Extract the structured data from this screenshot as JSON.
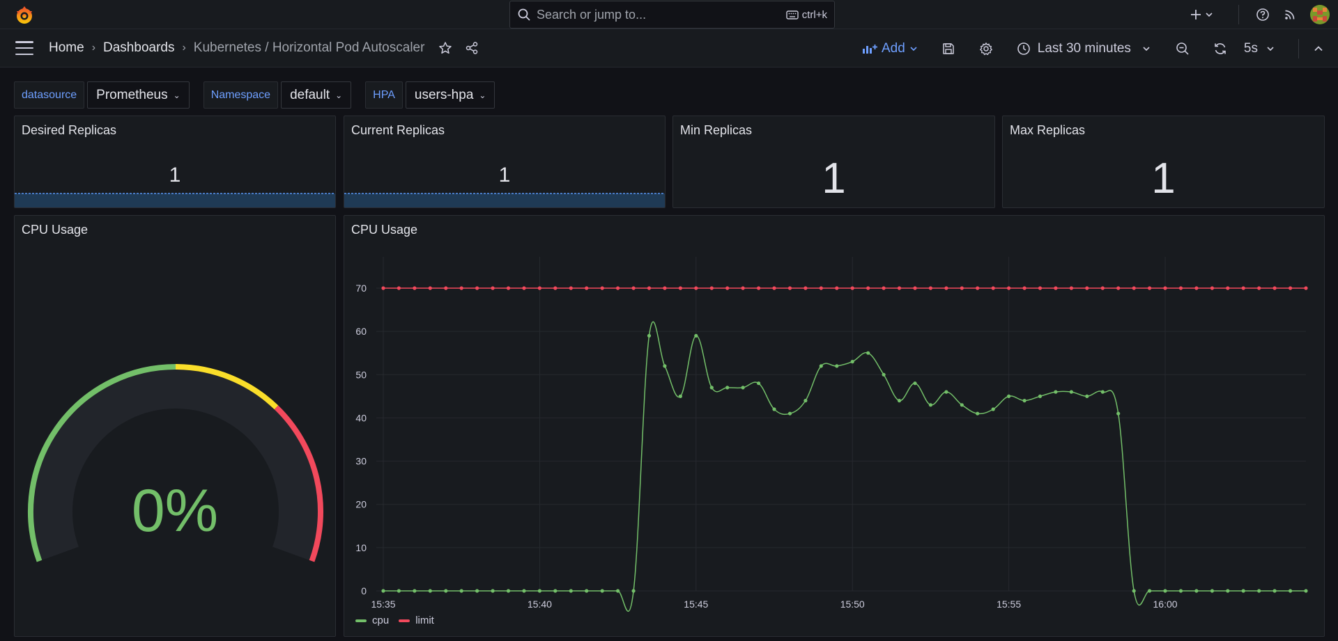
{
  "topbar": {
    "search_placeholder": "Search or jump to...",
    "search_shortcut": "ctrl+k",
    "icons": [
      "grafana-logo-icon",
      "search-icon",
      "keyboard-icon",
      "plus-icon",
      "help-icon",
      "news-rss-icon",
      "user-avatar"
    ]
  },
  "breadcrumb": {
    "home": "Home",
    "dashboards": "Dashboards",
    "current": "Kubernetes / Horizontal Pod Autoscaler"
  },
  "toolbar": {
    "add_label": "Add",
    "time_range": "Last 30 minutes",
    "refresh_interval": "5s"
  },
  "variables": [
    {
      "label": "datasource",
      "value": "Prometheus"
    },
    {
      "label": "Namespace",
      "value": "default"
    },
    {
      "label": "HPA",
      "value": "users-hpa"
    }
  ],
  "stats": {
    "desired": {
      "title": "Desired Replicas",
      "value": "1"
    },
    "current": {
      "title": "Current Replicas",
      "value": "1"
    },
    "min": {
      "title": "Min Replicas",
      "value": "1"
    },
    "max": {
      "title": "Max Replicas",
      "value": "1"
    }
  },
  "gauge": {
    "title": "CPU Usage",
    "value_text": "0%",
    "value": 0,
    "colors": {
      "green": "#73bf69",
      "yellow": "#fade2a",
      "red": "#f2495c",
      "track": "#22252b"
    }
  },
  "timeseries": {
    "title": "CPU Usage"
  },
  "chart_data": {
    "type": "line",
    "title": "CPU Usage",
    "xlabel": "",
    "ylabel": "",
    "ylim": [
      0,
      70
    ],
    "yticks": [
      0,
      10,
      20,
      30,
      40,
      50,
      60,
      70
    ],
    "x_tick_labels": [
      "15:35",
      "15:40",
      "15:45",
      "15:50",
      "15:55",
      "16:00"
    ],
    "x_start_label": "15:35",
    "x_end_label": "16:04:30",
    "grid": true,
    "legend": "bottom-left",
    "series": [
      {
        "name": "cpu",
        "color": "#73bf69",
        "values": [
          0,
          0,
          0,
          0,
          0,
          0,
          0,
          0,
          0,
          0,
          0,
          0,
          0,
          0,
          0,
          0,
          0,
          59,
          52,
          45,
          59,
          47,
          47,
          47,
          48,
          42,
          41,
          44,
          52,
          52,
          53,
          55,
          50,
          44,
          48,
          43,
          46,
          43,
          41,
          42,
          45,
          44,
          45,
          46,
          46,
          45,
          46,
          41,
          0,
          0,
          0,
          0,
          0,
          0,
          0,
          0,
          0,
          0,
          0,
          0
        ]
      },
      {
        "name": "limit",
        "color": "#f2495c",
        "values": [
          70,
          70,
          70,
          70,
          70,
          70,
          70,
          70,
          70,
          70,
          70,
          70,
          70,
          70,
          70,
          70,
          70,
          70,
          70,
          70,
          70,
          70,
          70,
          70,
          70,
          70,
          70,
          70,
          70,
          70,
          70,
          70,
          70,
          70,
          70,
          70,
          70,
          70,
          70,
          70,
          70,
          70,
          70,
          70,
          70,
          70,
          70,
          70,
          70,
          70,
          70,
          70,
          70,
          70,
          70,
          70,
          70,
          70,
          70,
          70
        ]
      }
    ]
  }
}
